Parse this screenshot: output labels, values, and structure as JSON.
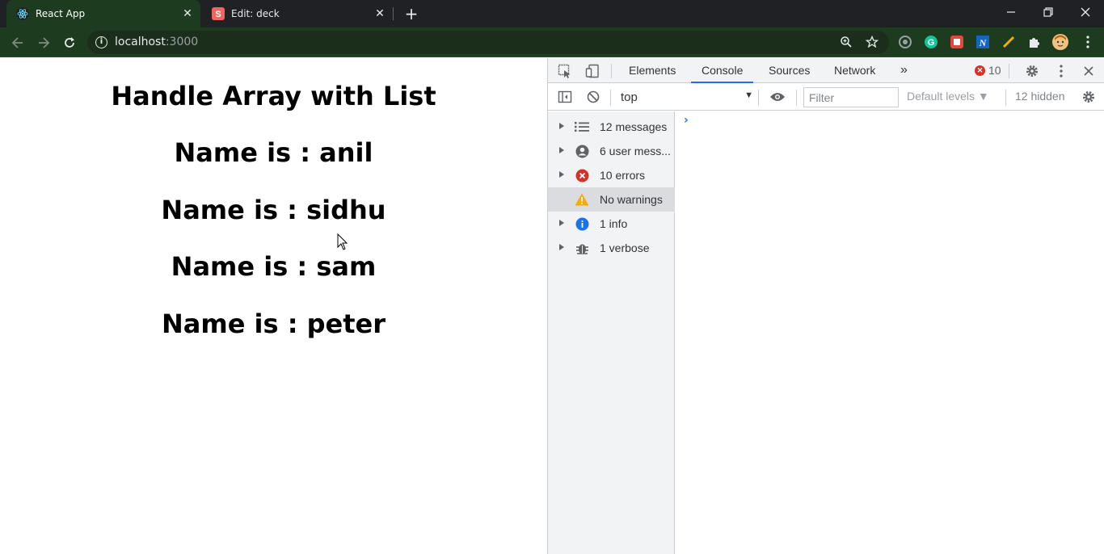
{
  "browser": {
    "tabs": [
      {
        "title": "React App",
        "active": true
      },
      {
        "title": "Edit: deck",
        "active": false
      }
    ],
    "new_tab_symbol": "+",
    "window_controls": {
      "minimize": "—",
      "restore": "❐",
      "close": "✕"
    },
    "nav": {
      "back": "←",
      "forward": "→",
      "reload": "↻"
    },
    "address": {
      "host": "localhost",
      "port": ":3000"
    },
    "colors": {
      "theme": "#1d3b1f",
      "tabbar": "#202124"
    }
  },
  "page": {
    "heading": "Handle Array with List",
    "names": [
      "Name is : anil",
      "Name is : sidhu",
      "Name is : sam",
      "Name is : peter"
    ]
  },
  "devtools": {
    "tabs": [
      "Elements",
      "Console",
      "Sources",
      "Network"
    ],
    "active_tab": "Console",
    "more_tabs": "»",
    "error_count": "10",
    "console_toolbar": {
      "context": "top",
      "filter_placeholder": "Filter",
      "levels": "Default levels ▼",
      "hidden": "12 hidden"
    },
    "sidebar": [
      {
        "label": "12 messages",
        "icon": "list-icon"
      },
      {
        "label": "6 user mess...",
        "icon": "user-icon"
      },
      {
        "label": "10 errors",
        "icon": "error-icon"
      },
      {
        "label": "No warnings",
        "icon": "warning-icon"
      },
      {
        "label": "1 info",
        "icon": "info-icon"
      },
      {
        "label": "1 verbose",
        "icon": "bug-icon"
      }
    ],
    "prompt": "›"
  }
}
